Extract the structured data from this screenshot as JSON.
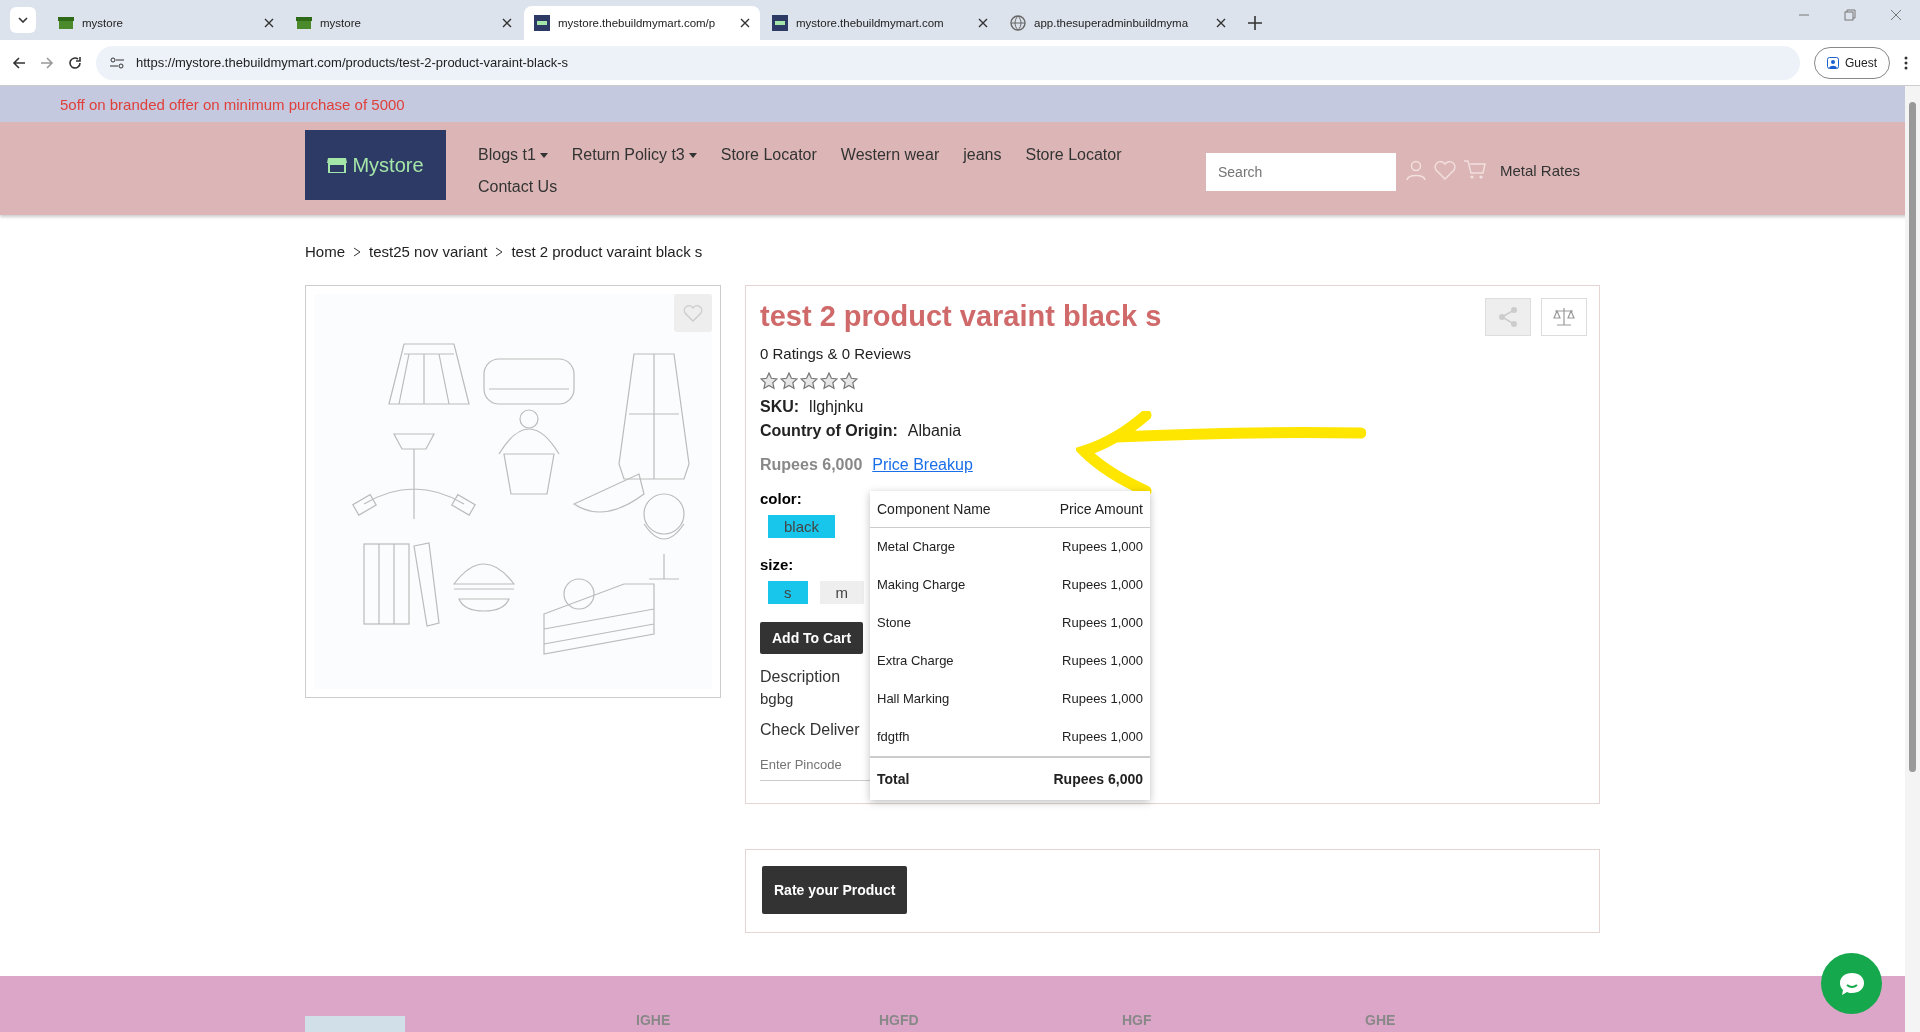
{
  "browser": {
    "tabs": [
      {
        "title": "mystore",
        "selected": false
      },
      {
        "title": "mystore",
        "selected": false
      },
      {
        "title": "mystore.thebuildmymart.com/p",
        "selected": true
      },
      {
        "title": "mystore.thebuildmymart.com",
        "selected": false
      },
      {
        "title": "app.thesuperadminbuildmyma",
        "selected": false
      }
    ],
    "url": "https://mystore.thebuildmymart.com/products/test-2-product-varaint-black-s",
    "profile": "Guest"
  },
  "promo": "5off on branded offer on minimum purchase of 5000",
  "header": {
    "logo": "Mystore",
    "nav": [
      {
        "label": "Blogs t1",
        "dropdown": true
      },
      {
        "label": "Return Policy t3",
        "dropdown": true
      },
      {
        "label": "Store Locator",
        "dropdown": false
      },
      {
        "label": "Western wear",
        "dropdown": false
      },
      {
        "label": "jeans",
        "dropdown": false
      },
      {
        "label": "Store Locator",
        "dropdown": false
      },
      {
        "label": "Contact Us",
        "dropdown": false
      }
    ],
    "search": {
      "placeholder": "Search"
    },
    "metal_rates": "Metal Rates"
  },
  "breadcrumb": [
    "Home",
    "test25 nov variant",
    "test 2 product varaint black s"
  ],
  "product": {
    "title": "test 2 product varaint black s",
    "ratings": "0 Ratings & 0 Reviews",
    "stars": 0,
    "details": [
      {
        "label": "SKU:",
        "value": "llghjnku"
      },
      {
        "label": "Country of Origin:",
        "value": "Albania"
      }
    ],
    "price": "Rupees 6,000",
    "price_link": "Price Breakup",
    "options": [
      {
        "label": "color:",
        "values": [
          {
            "text": "black",
            "selected": true
          }
        ]
      },
      {
        "label": "size:",
        "values": [
          {
            "text": "s",
            "selected": true
          },
          {
            "text": "m",
            "selected": false
          }
        ]
      }
    ],
    "add_to_cart": "Add To Cart",
    "description_label": "Description",
    "description": "bgbg",
    "delivery_label": "Check Deliver",
    "pincode": {
      "placeholder": "Enter Pincode"
    }
  },
  "price_breakup": {
    "columns": [
      "Component Name",
      "Price Amount"
    ],
    "rows": [
      [
        "Metal Charge",
        "Rupees 1,000"
      ],
      [
        "Making Charge",
        "Rupees 1,000"
      ],
      [
        "Stone",
        "Rupees 1,000"
      ],
      [
        "Extra Charge",
        "Rupees 1,000"
      ],
      [
        "Hall Marking",
        "Rupees 1,000"
      ],
      [
        "fdgtfh",
        "Rupees 1,000"
      ]
    ],
    "total": [
      "Total",
      "Rupees 6,000"
    ]
  },
  "rate_button": "Rate your Product",
  "footer": {
    "headings": [
      "IGHE",
      "HGFD",
      "HGF",
      "GHE"
    ]
  }
}
